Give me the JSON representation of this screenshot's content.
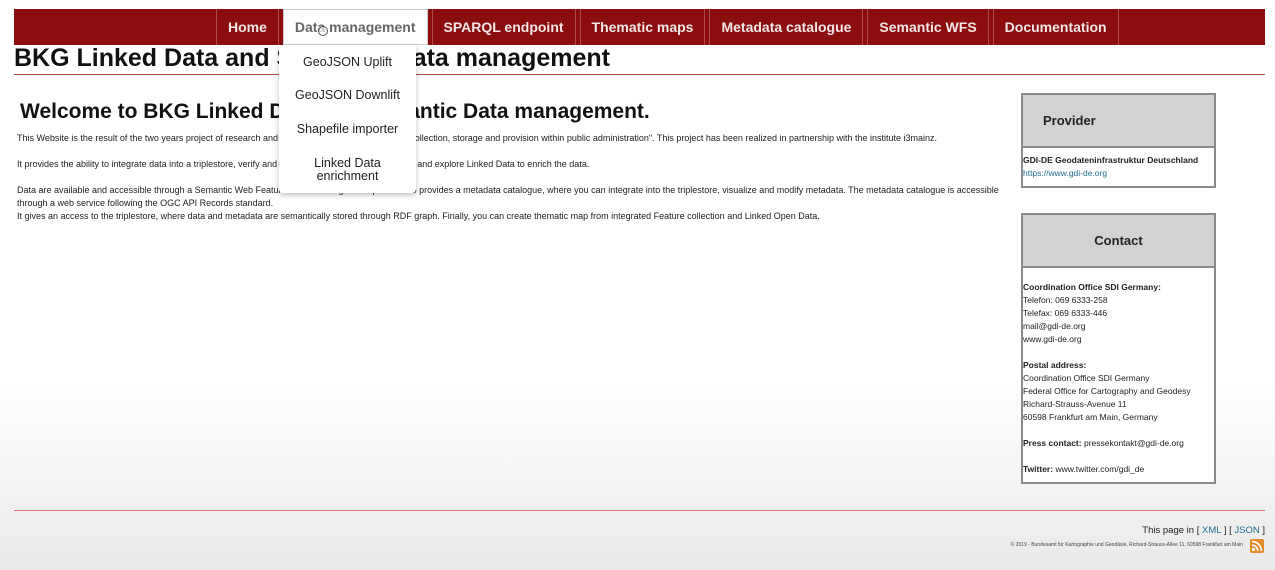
{
  "nav": {
    "items": [
      {
        "label": "Home"
      },
      {
        "label": "Data management"
      },
      {
        "label": "SPARQL endpoint"
      },
      {
        "label": "Thematic maps"
      },
      {
        "label": "Metadata catalogue"
      },
      {
        "label": "Semantic WFS"
      },
      {
        "label": "Documentation"
      }
    ],
    "active": "Data management"
  },
  "dropdown": {
    "items": [
      "GeoJSON Uplift",
      "GeoJSON Downlift",
      "Shapefile importer",
      "Linked Data enrichment"
    ]
  },
  "page": {
    "title": "BKG Linked Data and Semantic Data management",
    "welcome": "Welcome to BKG Linked Data and Semantic Data management.",
    "paragraphs": [
      "This Website is the result of the two years project of research and development on \"Semantic data collection, storage and provision within public administration\". This project has been realized in partnership with the institute i3mainz.",
      "It provides the ability to integrate data into a triplestore, verify and transform data by using schemas, and explore Linked Data to enrich the data.",
      "Data are available and accessible through a Semantic Web Feature Service being developed. It also provides a metadata catalogue, where you can integrate into the triplestore, visualize and modify metadata. The metadata catalogue is accessible through a web service following the OGC API Records standard.",
      "It gives an access to the triplestore, where data and metadata are semantically stored through RDF graph. Finally, you can create thematic map from integrated Feature collection and Linked Open Data."
    ]
  },
  "provider": {
    "heading": "Provider",
    "name": "GDI-DE Geodateninfrastruktur Deutschland",
    "url": "https://www.gdi-de.org"
  },
  "contact": {
    "heading": "Contact",
    "office_label": "Coordination Office SDI Germany:",
    "phone": "Telefon: 069 6333-258",
    "fax": "Telefax: 069 6333-446",
    "email": "mail@gdi-de.org",
    "web": "www.gdi-de.org",
    "postal_label": "Postal address:",
    "postal_lines": [
      "Coordination Office SDI Germany",
      "Federal Office for Cartography and Geodesy",
      "Richard-Strauss-Avenue 11",
      "60598 Frankfurt am Main, Germany"
    ],
    "press_label": "Press contact:",
    "press_value": "pressekontakt@gdi-de.org",
    "twitter_label": "Twitter:",
    "twitter_value": "www.twitter.com/gdi_de"
  },
  "footer": {
    "formats_prefix": "This page in",
    "formats_open1": "[",
    "xml": "XML",
    "formats_sep": "] [",
    "json": "JSON",
    "formats_close": "]",
    "copyright": "© 2019 - Bundesamt für Kartographie und Geodäsie, Richard-Strauss-Allee 11, 60598 Frankfurt am Main"
  },
  "colors": {
    "nav_bg": "#8b0d0d",
    "link": "#1f6d8c",
    "rss": "#e58a2b"
  },
  "icons": [
    "cursor-icon",
    "rss-feed-icon"
  ]
}
